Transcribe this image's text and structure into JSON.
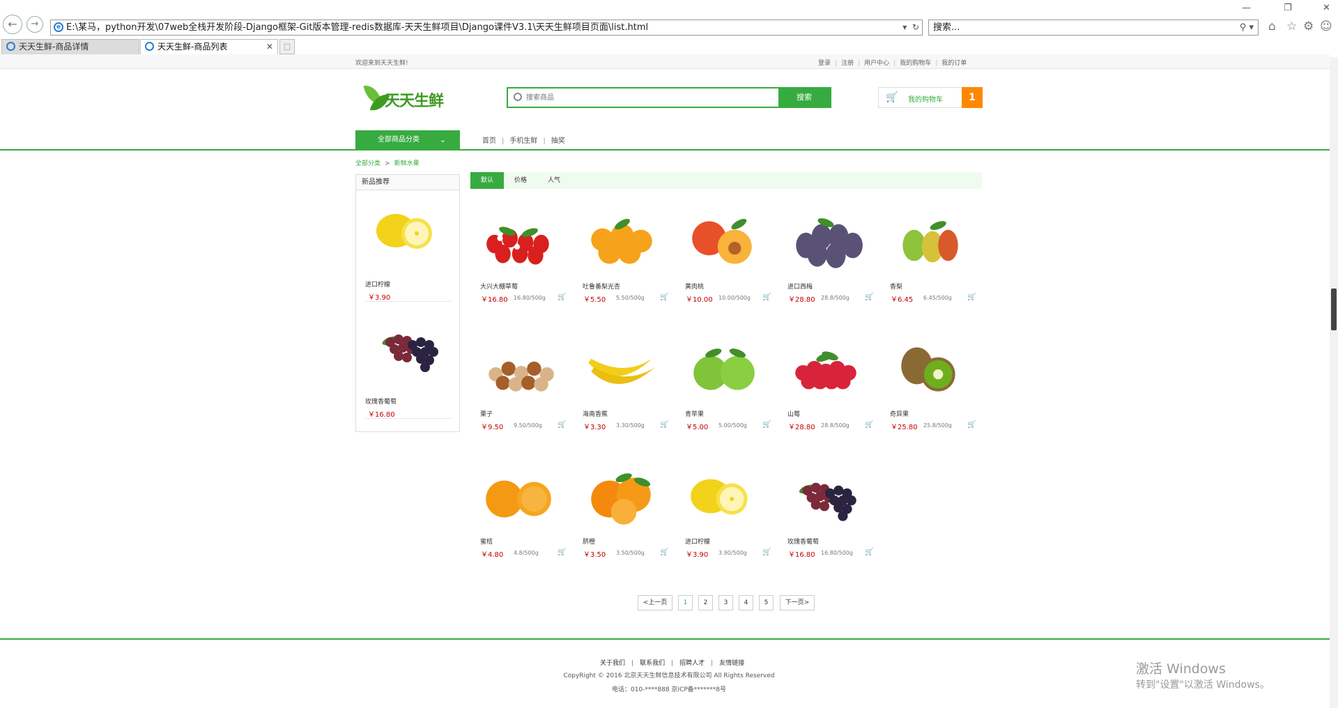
{
  "browser": {
    "address": "E:\\某马，python开发\\07web全栈开发阶段-Django框架-Git版本管理-redis数据库-天天生鲜项目\\Django课件V3.1\\天天生鲜项目页面\\list.html",
    "search_placeholder": "搜索...",
    "tabs": [
      {
        "label": "天天生鲜-商品详情"
      },
      {
        "label": "天天生鲜-商品列表"
      }
    ]
  },
  "topbar": {
    "welcome": "欢迎来到天天生鲜!",
    "links": [
      "登录",
      "注册",
      "用户中心",
      "我的购物车",
      "我的订单"
    ]
  },
  "header": {
    "logo_text": "天天生鲜",
    "search_placeholder": "搜索商品",
    "search_button": "搜索",
    "cart_label": "我的购物车",
    "cart_count": "1"
  },
  "nav": {
    "all_categories": "全部商品分类",
    "links": [
      "首页",
      "手机生鲜",
      "抽奖"
    ]
  },
  "breadcrumb": [
    "全部分类",
    "新鲜水果"
  ],
  "new_products": {
    "title": "新品推荐",
    "items": [
      {
        "name": "进口柠檬",
        "price": "￥3.90",
        "pic": "lemon"
      },
      {
        "name": "玫瑰香葡萄",
        "price": "￥16.80",
        "pic": "grape"
      }
    ]
  },
  "sort": [
    "默认",
    "价格",
    "人气"
  ],
  "products": [
    {
      "name": "大兴大棚草莓",
      "price": "￥16.80",
      "unit": "16.80/500g",
      "pic": "strawberry"
    },
    {
      "name": "吐鲁番梨光杏",
      "price": "￥5.50",
      "unit": "5.50/500g",
      "pic": "apricot"
    },
    {
      "name": "黄肉桃",
      "price": "￥10.00",
      "unit": "10.00/500g",
      "pic": "peach"
    },
    {
      "name": "进口西梅",
      "price": "￥28.80",
      "unit": "28.8/500g",
      "pic": "plum"
    },
    {
      "name": "香梨",
      "price": "￥6.45",
      "unit": "6.45/500g",
      "pic": "pear"
    },
    {
      "name": "栗子",
      "price": "￥9.50",
      "unit": "9.50/500g",
      "pic": "nuts"
    },
    {
      "name": "海南香蕉",
      "price": "￥3.30",
      "unit": "3.30/500g",
      "pic": "banana"
    },
    {
      "name": "青苹果",
      "price": "￥5.00",
      "unit": "5.00/500g",
      "pic": "apple"
    },
    {
      "name": "山莓",
      "price": "￥28.80",
      "unit": "28.8/500g",
      "pic": "raspberry"
    },
    {
      "name": "奇异果",
      "price": "￥25.80",
      "unit": "25.8/500g",
      "pic": "kiwi"
    },
    {
      "name": "蜜桔",
      "price": "￥4.80",
      "unit": "4.8/500g",
      "pic": "mandarin"
    },
    {
      "name": "脐橙",
      "price": "￥3.50",
      "unit": "3.50/500g",
      "pic": "orange"
    },
    {
      "name": "进口柠檬",
      "price": "￥3.90",
      "unit": "3.90/500g",
      "pic": "lemon"
    },
    {
      "name": "玫瑰香葡萄",
      "price": "￥16.80",
      "unit": "16.80/500g",
      "pic": "grape"
    }
  ],
  "pagination": [
    "<上一页",
    "1",
    "2",
    "3",
    "4",
    "5",
    "下一页>"
  ],
  "footer": {
    "links": [
      "关于我们",
      "联系我们",
      "招聘人才",
      "友情链接"
    ],
    "copyright": "CopyRight © 2016 北京天天生鲜信息技术有限公司 All Rights Reserved",
    "phone": "电话：010-****888 京ICP备*******8号"
  },
  "activation": {
    "line1": "激活 Windows",
    "line2": "转到\"设置\"以激活 Windows。"
  },
  "colors": {
    "brand_green": "#37ab40",
    "price_red": "#c40000",
    "cart_orange": "#ff8800"
  }
}
